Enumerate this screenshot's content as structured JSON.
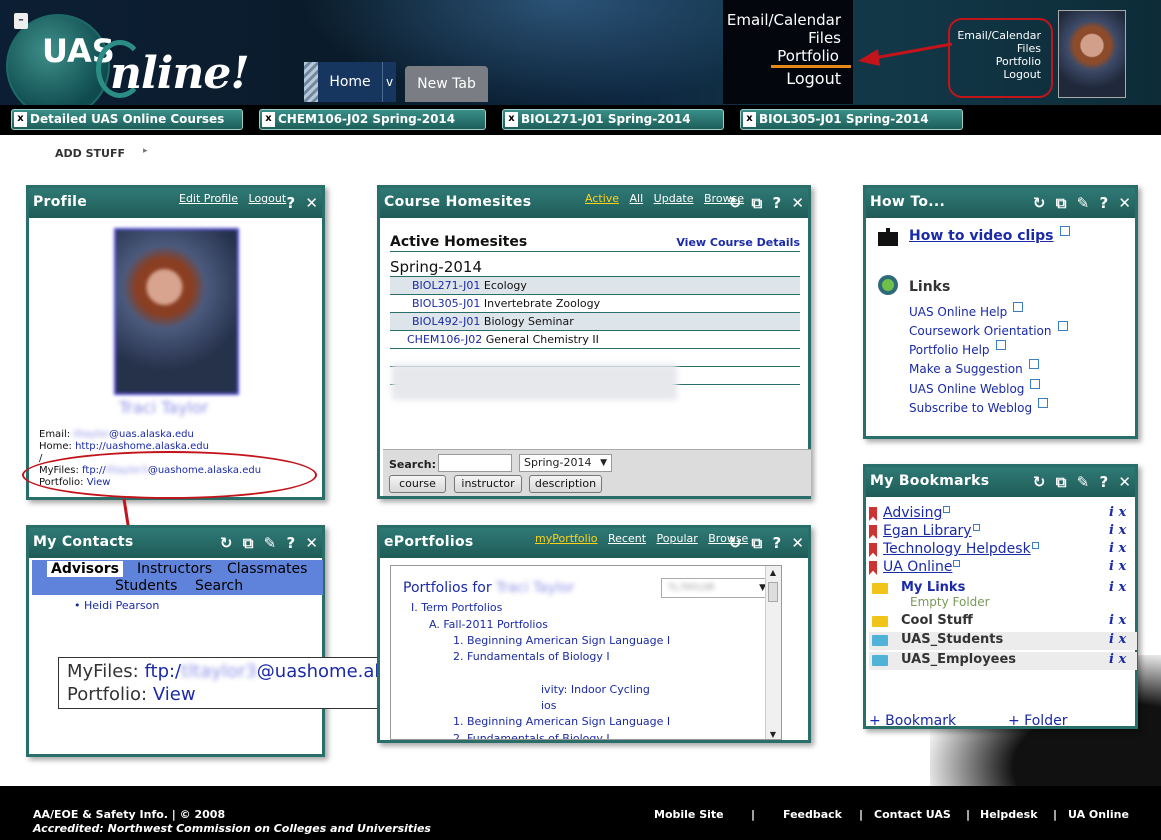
{
  "header": {
    "logo_uas": "UAS",
    "logo_online": "nline!",
    "menu_toggle": "–",
    "tabs": [
      {
        "label": "Home"
      },
      {
        "label": "New Tab"
      }
    ],
    "tab_menu": "v",
    "user_menu": [
      "Email/Calendar",
      "Files",
      "Portfolio",
      "Logout"
    ],
    "user_menu_small": [
      "Email/Calendar",
      "Files",
      "Portfolio",
      "Logout"
    ],
    "accent_color": "#e48a1a",
    "annotation_color": "#c2141a"
  },
  "course_tabs": [
    {
      "close": "x",
      "label": "Detailed UAS Online Courses"
    },
    {
      "close": "x",
      "label": "CHEM106-J02 Spring-2014"
    },
    {
      "close": "x",
      "label": "BIOL271-J01 Spring-2014"
    },
    {
      "close": "x",
      "label": "BIOL305-J01 Spring-2014"
    }
  ],
  "add_stuff": "ADD STUFF",
  "add_stuff_arrow": "▸",
  "profile": {
    "title": "Profile",
    "links": [
      "Edit Profile",
      "Logout"
    ],
    "name": "Traci Taylor",
    "email_label": "Email:",
    "email_value": "@uas.alaska.edu",
    "home_label": "Home:",
    "home_value": "http://uashome.alaska.edu",
    "myfiles_label": "MyFiles:",
    "myfiles_prefix": "ftp://",
    "myfiles_value": "@uashome.alaska.edu",
    "portfolio_label": "Portfolio:",
    "portfolio_link": "View"
  },
  "contacts": {
    "title": "My Contacts",
    "tabs": [
      "Advisors",
      "Instructors",
      "Classmates",
      "Students",
      "Search"
    ],
    "people": [
      "Heidi Pearson"
    ]
  },
  "callout": {
    "myfiles_label": "MyFiles:",
    "myfiles_prefix": "ftp:/",
    "myfiles_value": "@uashome.alaska.edu",
    "portfolio_label": "Portfolio:",
    "portfolio_link": "View"
  },
  "homesites": {
    "title": "Course Homesites",
    "links": [
      "Active",
      "All",
      "Update",
      "Browse"
    ],
    "heading": "Active Homesites",
    "details_link": "View Course Details",
    "term": "Spring-2014",
    "rows": [
      {
        "code": "BIOL271-J01",
        "name": "Ecology"
      },
      {
        "code": "BIOL305-J01",
        "name": "Invertebrate Zoology"
      },
      {
        "code": "BIOL492-J01",
        "name": "Biology Seminar"
      },
      {
        "code": "CHEM106-J02",
        "name": "General Chemistry II"
      }
    ],
    "search_label": "Search:",
    "search_term": "Spring-2014",
    "buttons": [
      "course",
      "instructor",
      "description"
    ]
  },
  "eportfolios": {
    "title": "ePortfolios",
    "links": [
      "myPortfolio",
      "Recent",
      "Popular",
      "Browse"
    ],
    "portfolios_for": "Portfolios for",
    "owner": "Traci Taylor",
    "items": [
      "I.  Term Portfolios",
      "A.  Fall-2011 Portfolios",
      "1.  Beginning American Sign Language I",
      "2.  Fundamentals of Biology I",
      "ivity: Indoor Cycling",
      "ios",
      "1.  Beginning American Sign Language I",
      "2.  Fundamentals of Biology I"
    ]
  },
  "howto": {
    "title": "How To...",
    "video_link": "How to video clips",
    "links_heading": "Links",
    "links": [
      "UAS Online Help",
      "Coursework Orientation",
      "Portfolio Help",
      "Make a Suggestion",
      "UAS Online Weblog",
      "Subscribe to Weblog"
    ]
  },
  "bookmarks": {
    "title": "My Bookmarks",
    "items": [
      "Advising",
      "Egan Library",
      "Technology Helpdesk",
      "UA Online"
    ],
    "folders": [
      {
        "name": "My Links",
        "note": "Empty Folder"
      },
      {
        "name": "Cool Stuff"
      },
      {
        "name": "UAS_Students"
      },
      {
        "name": "UAS_Employees"
      }
    ],
    "info_icon": "i",
    "delete_icon": "x",
    "add_bookmark": "+ Bookmark",
    "add_folder": "+ Folder"
  },
  "panel_icons": {
    "refresh": "↻",
    "window": "⧉",
    "edit": "✎",
    "help": "?",
    "close": "✕"
  },
  "footer": {
    "line1": "AA/EOE & Safety Info. | © 2008",
    "line2": "Accredited: Northwest Commission on Colleges and Universities",
    "links": [
      "Mobile Site",
      "Feedback",
      "Contact UAS",
      "Helpdesk",
      "UA Online"
    ],
    "separator": "|"
  }
}
